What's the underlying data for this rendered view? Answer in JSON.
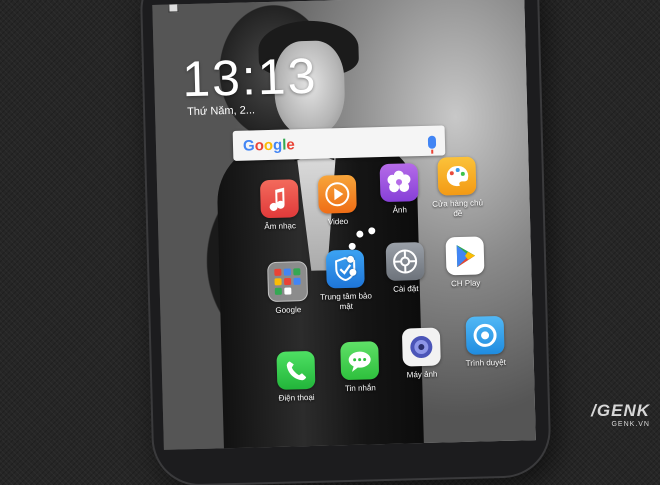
{
  "lockscreen": {
    "time": "13:13",
    "date": "Thứ Năm, 2..."
  },
  "search": {
    "logo_letters": [
      "G",
      "o",
      "o",
      "g",
      "l",
      "e"
    ]
  },
  "apps": [
    {
      "label": "Âm nhạc",
      "icon": "music-icon",
      "color": "#e8463c"
    },
    {
      "label": "Video",
      "icon": "video-play-icon",
      "color": "#f08a1c"
    },
    {
      "label": "Ảnh",
      "icon": "photo-flower-icon",
      "color": "#9c4de0"
    },
    {
      "label": "Cửa hàng chủ đề",
      "icon": "theme-palette-icon",
      "color": "#f5a21b"
    },
    {
      "label": "Google",
      "icon": "google-folder-icon",
      "color": "#cfcfcf"
    },
    {
      "label": "Trung tâm bảo mật",
      "icon": "security-shield-icon",
      "color": "#2a8be6"
    },
    {
      "label": "Cài đặt",
      "icon": "settings-gear-icon",
      "color": "#8a8f98"
    },
    {
      "label": "CH Play",
      "icon": "play-store-icon",
      "color": "#ffffff"
    },
    {
      "label": "Điện thoại",
      "icon": "phone-icon",
      "color": "#2fcb46"
    },
    {
      "label": "Tin nhắn",
      "icon": "messages-icon",
      "color": "#3fcc48"
    },
    {
      "label": "Máy ảnh",
      "icon": "camera-icon",
      "color": "#5d69c9"
    },
    {
      "label": "Trình duyệt",
      "icon": "browser-icon",
      "color": "#3aa2f0"
    }
  ],
  "watermark": {
    "main": "/GENK",
    "sub": "GENK.VN"
  }
}
